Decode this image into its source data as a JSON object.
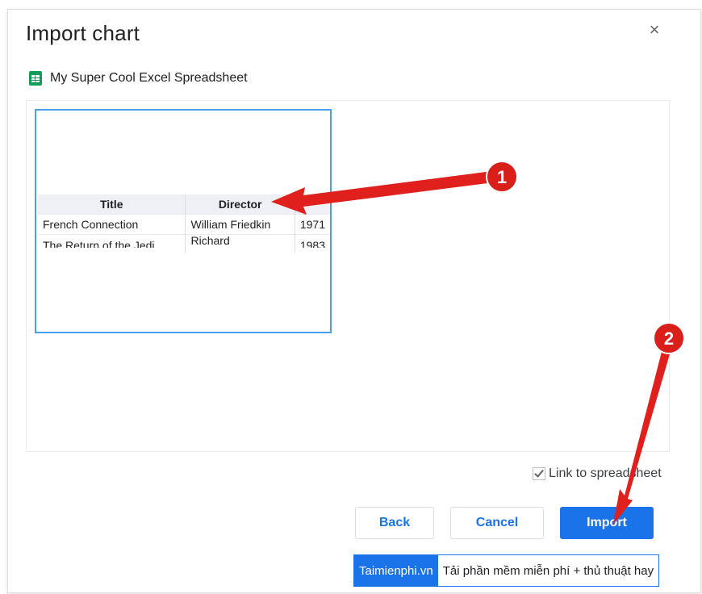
{
  "dialog": {
    "title": "Import chart",
    "close_glyph": "×",
    "source_icon": "sheets-icon",
    "source_name": "My Super Cool Excel Spreadsheet"
  },
  "preview_table": {
    "headers": [
      "Title",
      "Director",
      ""
    ],
    "rows": [
      [
        "French Connection",
        "William Friedkin",
        "1971"
      ],
      [
        "The Return of the Jedi",
        "Richard",
        "1983"
      ]
    ]
  },
  "link_checkbox": {
    "label": "Link to spreadsheet",
    "checked": true
  },
  "buttons": {
    "back": "Back",
    "cancel": "Cancel",
    "import": "Import"
  },
  "annotations": {
    "marker_1": "1",
    "marker_2": "2"
  },
  "watermark": {
    "brand": "Taimienphi.vn",
    "tagline": "Tải phần mềm miễn phí + thủ thuật hay"
  },
  "colors": {
    "accent": "#1a73e8",
    "selection_border": "#4a9eed",
    "annotation_red": "#e0201c"
  }
}
